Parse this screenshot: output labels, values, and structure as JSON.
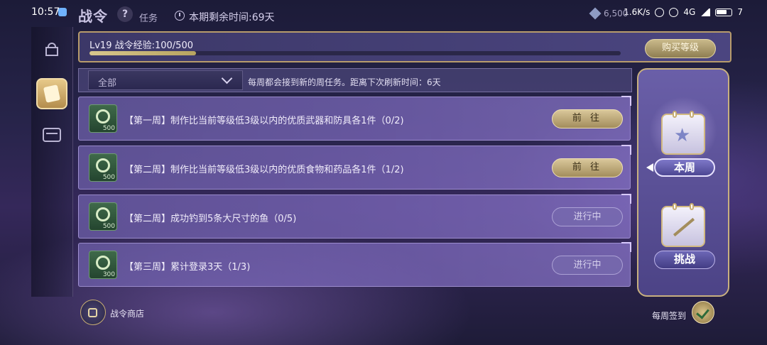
{
  "status_bar": {
    "time": "10:57",
    "network_speed": "1.6K/s",
    "signal": "4G",
    "battery": "7"
  },
  "header": {
    "title": "战令",
    "help": "?",
    "tab_task": "任务",
    "remaining": "本期剩余时间:69天",
    "currency": "6,500"
  },
  "xp": {
    "label": "Lv19 战令经验:100/500",
    "current": 100,
    "max": 500,
    "buy_label": "购买等级"
  },
  "filter": {
    "selected": "全部",
    "note": "每周都会接到新的周任务。距离下次刷新时间：6天"
  },
  "tasks": [
    {
      "text": "【第一周】制作比当前等级低3级以内的优质武器和防具各1件（0/2)",
      "reward": "500",
      "action": "前 往"
    },
    {
      "text": "【第二周】制作比当前等级低3级以内的优质食物和药品各1件（1/2)",
      "reward": "500",
      "action": "前 往"
    },
    {
      "text": "【第二周】成功钓到5条大尺寸的鱼（0/5)",
      "reward": "500",
      "action": "进行中"
    },
    {
      "text": "【第三周】累计登录3天（1/3)",
      "reward": "300",
      "action": "进行中"
    }
  ],
  "side": {
    "this_week": "本周",
    "challenge": "挑战"
  },
  "bottom": {
    "shop": "战令商店",
    "weekly_signin": "每周签到"
  },
  "colors": {
    "accent_gold": "#c8b07f",
    "panel_purple": "#6a5fa8",
    "bg_dark": "#1c1b38"
  },
  "icons": [
    "gift-icon",
    "battlepass-icon",
    "bag-icon",
    "clock-icon",
    "gem-icon",
    "clover-icon",
    "calendar-star-icon",
    "calendar-sword-icon",
    "shop-icon",
    "signin-icon"
  ]
}
